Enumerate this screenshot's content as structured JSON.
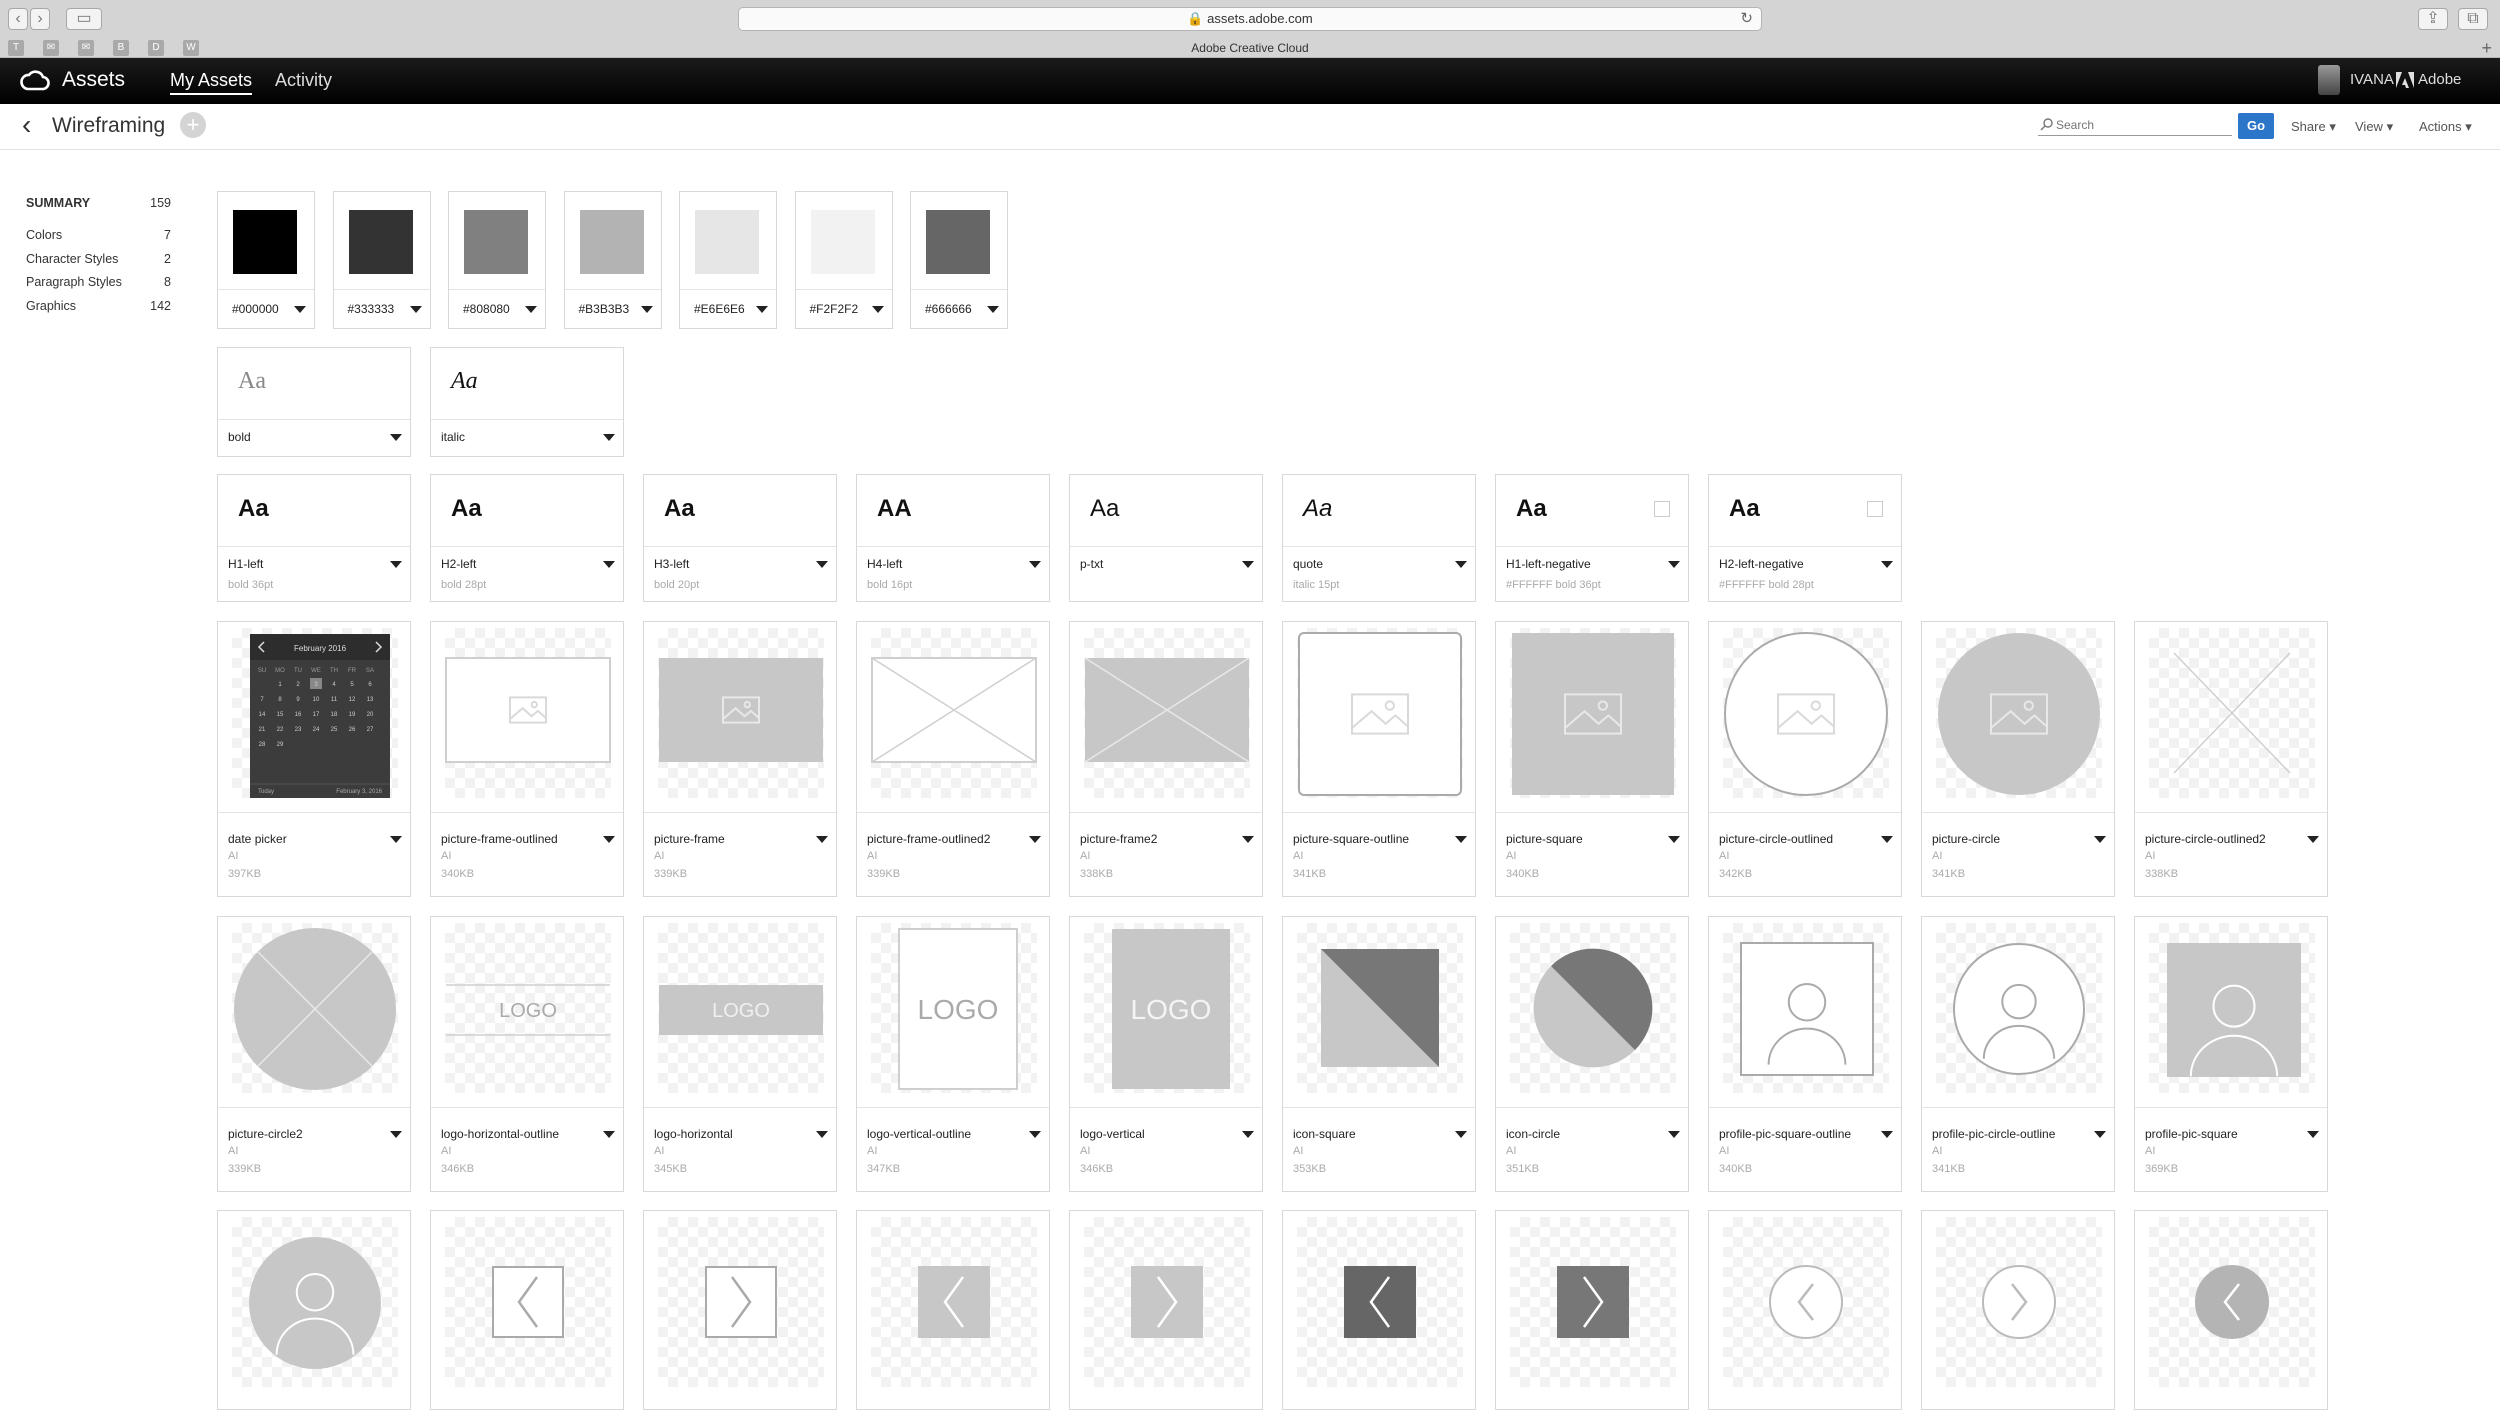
{
  "browser": {
    "url": "assets.adobe.com",
    "tab_title": "Adobe Creative Cloud"
  },
  "app": {
    "brand": "Assets",
    "tabs": [
      "My Assets",
      "Activity"
    ],
    "user": "IVANA",
    "adobe_label": "Adobe"
  },
  "toolbar": {
    "title": "Wireframing",
    "search_placeholder": "Search",
    "go_label": "Go",
    "menus": [
      "Share",
      "View",
      "Actions"
    ]
  },
  "sidebar": {
    "summary_label": "SUMMARY",
    "summary_count": "159",
    "items": [
      {
        "label": "Colors",
        "count": "7"
      },
      {
        "label": "Character Styles",
        "count": "2"
      },
      {
        "label": "Paragraph Styles",
        "count": "8"
      },
      {
        "label": "Graphics",
        "count": "142"
      }
    ]
  },
  "colors": [
    {
      "hex": "#000000",
      "label": "#000000"
    },
    {
      "hex": "#333333",
      "label": "#333333"
    },
    {
      "hex": "#808080",
      "label": "#808080"
    },
    {
      "hex": "#B3B3B3",
      "label": "#B3B3B3"
    },
    {
      "hex": "#E6E6E6",
      "label": "#E6E6E6"
    },
    {
      "hex": "#F2F2F2",
      "label": "#F2F2F2"
    },
    {
      "hex": "#666666",
      "label": "#666666"
    }
  ],
  "char_styles": [
    {
      "sample": "Aa",
      "name": "bold",
      "style": "normal"
    },
    {
      "sample": "Aa",
      "name": "italic",
      "style": "italic"
    }
  ],
  "para_styles": [
    {
      "sample": "Aa",
      "name": "H1-left",
      "meta": "bold  36pt",
      "weight": "bold",
      "style": "normal",
      "checkbox": false
    },
    {
      "sample": "Aa",
      "name": "H2-left",
      "meta": "bold  28pt",
      "weight": "bold",
      "style": "normal",
      "checkbox": false
    },
    {
      "sample": "Aa",
      "name": "H3-left",
      "meta": "bold  20pt",
      "weight": "bold",
      "style": "normal",
      "checkbox": false
    },
    {
      "sample": "AA",
      "name": "H4-left",
      "meta": "bold  16pt",
      "weight": "bold",
      "style": "normal",
      "checkbox": false
    },
    {
      "sample": "Aa",
      "name": "p-txt",
      "meta": "",
      "weight": "normal",
      "style": "normal",
      "checkbox": false
    },
    {
      "sample": "Aa",
      "name": "quote",
      "meta": "italic  15pt",
      "weight": "normal",
      "style": "italic",
      "checkbox": false
    },
    {
      "sample": "Aa",
      "name": "H1-left-negative",
      "meta": "#FFFFFF  bold  36pt",
      "weight": "bold",
      "style": "normal",
      "checkbox": true
    },
    {
      "sample": "Aa",
      "name": "H2-left-negative",
      "meta": "#FFFFFF  bold  28pt",
      "weight": "bold",
      "style": "normal",
      "checkbox": true
    }
  ],
  "graphics_row1": [
    {
      "name": "date picker",
      "type": "AI",
      "size": "397KB",
      "icon": "date-picker"
    },
    {
      "name": "picture-frame-outlined",
      "type": "AI",
      "size": "340KB",
      "icon": "frame-outlined"
    },
    {
      "name": "picture-frame",
      "type": "AI",
      "size": "339KB",
      "icon": "frame-filled"
    },
    {
      "name": "picture-frame-outlined2",
      "type": "AI",
      "size": "339KB",
      "icon": "frame-x-outlined"
    },
    {
      "name": "picture-frame2",
      "type": "AI",
      "size": "338KB",
      "icon": "frame-x-filled"
    },
    {
      "name": "picture-square-outline",
      "type": "AI",
      "size": "341KB",
      "icon": "square-outlined"
    },
    {
      "name": "picture-square",
      "type": "AI",
      "size": "340KB",
      "icon": "square-filled"
    },
    {
      "name": "picture-circle-outlined",
      "type": "AI",
      "size": "342KB",
      "icon": "circle-outlined"
    },
    {
      "name": "picture-circle",
      "type": "AI",
      "size": "341KB",
      "icon": "circle-filled"
    },
    {
      "name": "picture-circle-outlined2",
      "type": "AI",
      "size": "338KB",
      "icon": "x-lines"
    }
  ],
  "graphics_row2": [
    {
      "name": "picture-circle2",
      "type": "AI",
      "size": "339KB",
      "icon": "circle-x-filled"
    },
    {
      "name": "logo-horizontal-outline",
      "type": "AI",
      "size": "346KB",
      "icon": "logo-h-outline"
    },
    {
      "name": "logo-horizontal",
      "type": "AI",
      "size": "345KB",
      "icon": "logo-h-filled"
    },
    {
      "name": "logo-vertical-outline",
      "type": "AI",
      "size": "347KB",
      "icon": "logo-v-outline"
    },
    {
      "name": "logo-vertical",
      "type": "AI",
      "size": "346KB",
      "icon": "logo-v-filled"
    },
    {
      "name": "icon-square",
      "type": "AI",
      "size": "353KB",
      "icon": "icon-square"
    },
    {
      "name": "icon-circle",
      "type": "AI",
      "size": "351KB",
      "icon": "icon-circle"
    },
    {
      "name": "profile-pic-square-outline",
      "type": "AI",
      "size": "340KB",
      "icon": "profile-square-outline"
    },
    {
      "name": "profile-pic-circle-outline",
      "type": "AI",
      "size": "341KB",
      "icon": "profile-circle-outline"
    },
    {
      "name": "profile-pic-square",
      "type": "AI",
      "size": "369KB",
      "icon": "profile-square-filled"
    }
  ],
  "graphics_row3": [
    {
      "icon": "profile-circle-filled"
    },
    {
      "icon": "arrow-left-square-outline"
    },
    {
      "icon": "arrow-right-square-outline"
    },
    {
      "icon": "arrow-left-square-light"
    },
    {
      "icon": "arrow-right-square-light"
    },
    {
      "icon": "arrow-left-square-dark"
    },
    {
      "icon": "arrow-right-square-dark"
    },
    {
      "icon": "arrow-left-circle-outline"
    },
    {
      "icon": "arrow-right-circle-outline"
    },
    {
      "icon": "arrow-left-circle-filled"
    }
  ],
  "logo_text": "LOGO",
  "calendar": {
    "month": "February 2016",
    "days": [
      "SU",
      "MO",
      "TU",
      "WE",
      "TH",
      "FR",
      "SA"
    ],
    "footer_left": "Today",
    "footer_right": "February 3, 2016"
  }
}
